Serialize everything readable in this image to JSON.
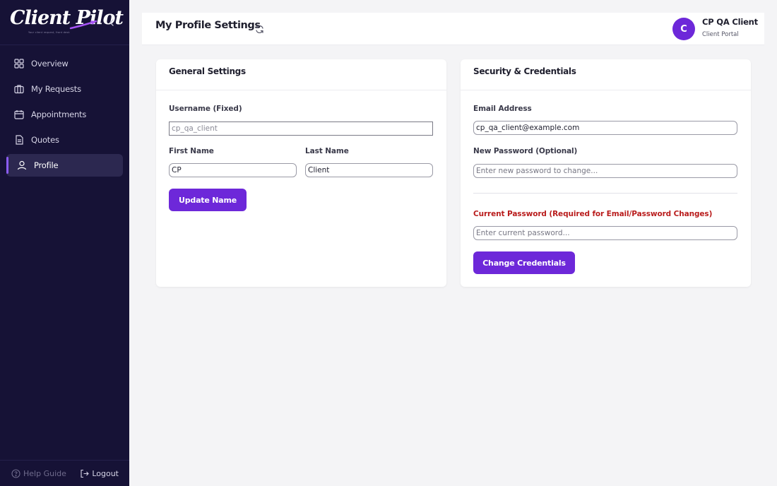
{
  "sidebar": {
    "logo_text": "Client Pilot",
    "logo_tagline": "Your client request, front desk",
    "nav_items": [
      {
        "label": "Overview",
        "icon": "grid-icon",
        "active": false
      },
      {
        "label": "My Requests",
        "icon": "briefcase-icon",
        "active": false
      },
      {
        "label": "Appointments",
        "icon": "calendar-icon",
        "active": false
      },
      {
        "label": "Quotes",
        "icon": "document-icon",
        "active": false
      },
      {
        "label": "Profile",
        "icon": "user-icon",
        "active": true
      }
    ],
    "help_label": "Help Guide",
    "logout_label": "Logout"
  },
  "header": {
    "title": "My Profile Settings",
    "avatar_initial": "C",
    "user_name": "CP QA Client",
    "user_role": "Client Portal"
  },
  "general": {
    "title": "General Settings",
    "username_label": "Username (Fixed)",
    "username_value": "cp_qa_client",
    "first_name_label": "First Name",
    "first_name_value": "CP",
    "last_name_label": "Last Name",
    "last_name_value": "Client",
    "update_button": "Update Name"
  },
  "security": {
    "title": "Security & Credentials",
    "email_label": "Email Address",
    "email_value": "cp_qa_client@example.com",
    "new_password_label": "New Password (Optional)",
    "new_password_placeholder": "Enter new password to change...",
    "current_password_label": "Current Password (Required for Email/Password Changes)",
    "current_password_placeholder": "Enter current password...",
    "change_button": "Change Credentials"
  },
  "colors": {
    "sidebar_bg": "#161236",
    "accent": "#6d28d9",
    "warning_label": "#b91c1c"
  }
}
